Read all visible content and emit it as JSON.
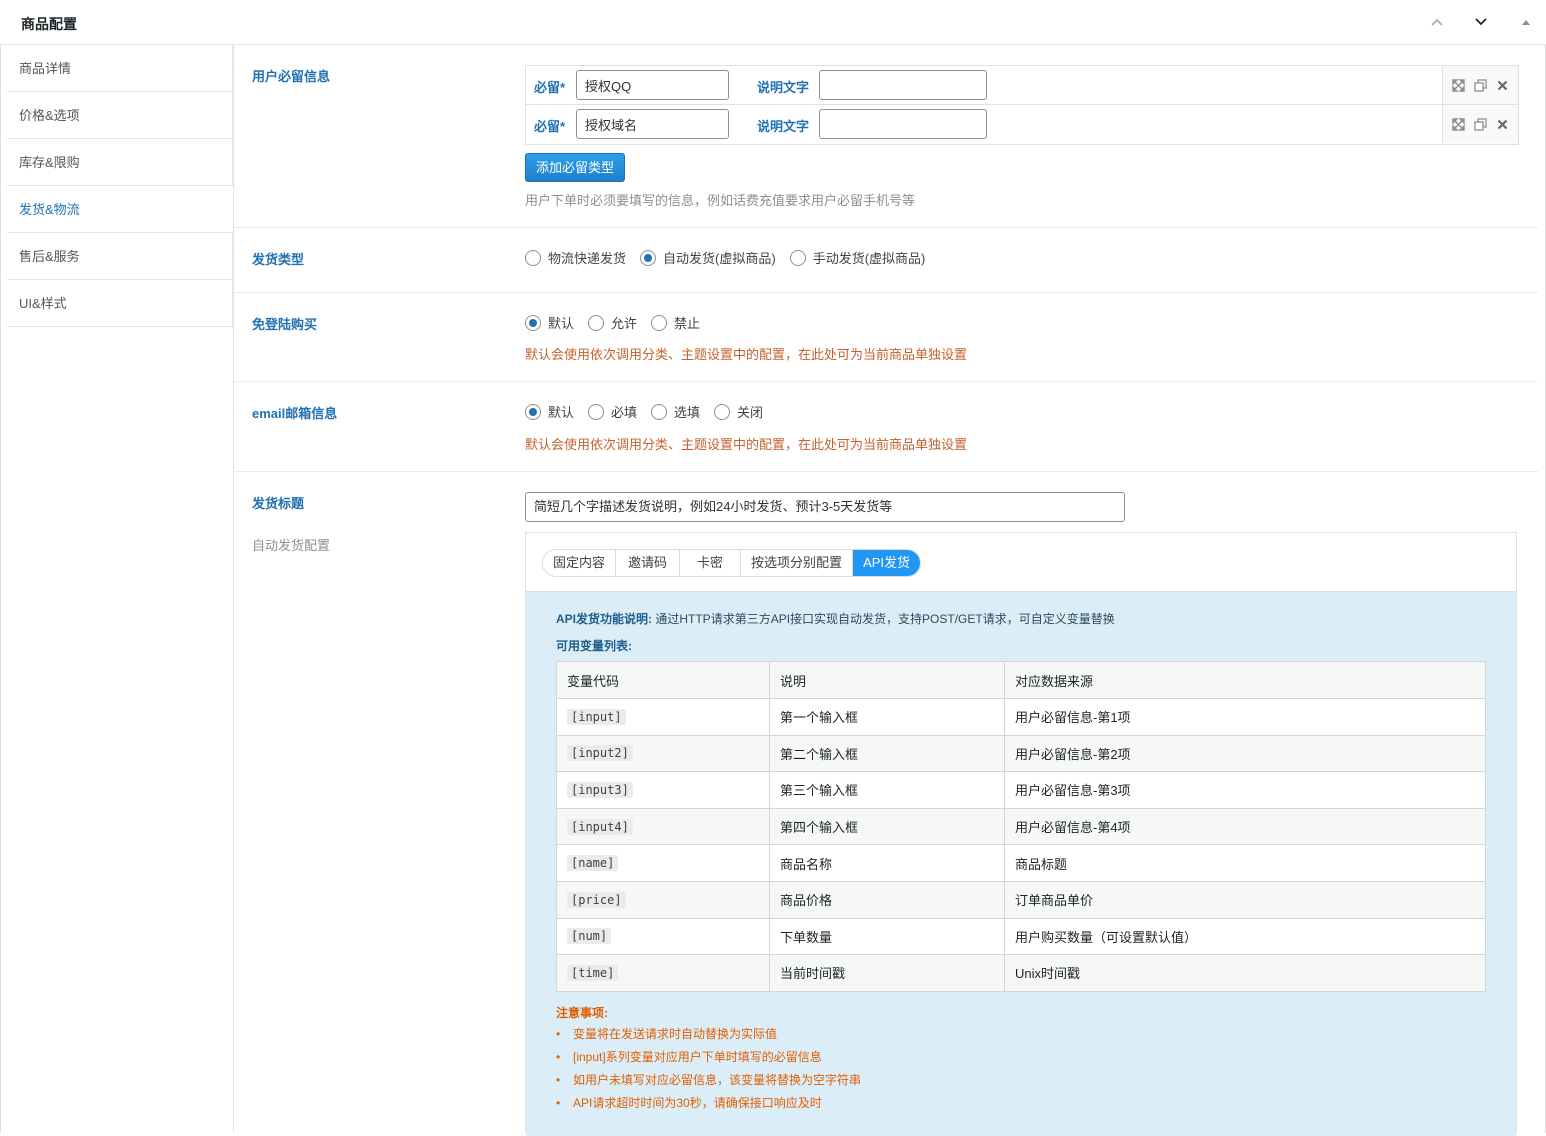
{
  "header": {
    "title": "商品配置"
  },
  "sidebar": {
    "items": [
      {
        "label": "商品详情"
      },
      {
        "label": "价格&选项"
      },
      {
        "label": "库存&限购"
      },
      {
        "label": "发货&物流"
      },
      {
        "label": "售后&服务"
      },
      {
        "label": "UI&样式"
      }
    ],
    "active_index": 3
  },
  "required_info": {
    "label": "用户必留信息",
    "rows": [
      {
        "req_label": "必留*",
        "value": "授权QQ",
        "desc_label": "说明文字",
        "desc_value": ""
      },
      {
        "req_label": "必留*",
        "value": "授权域名",
        "desc_label": "说明文字",
        "desc_value": ""
      }
    ],
    "add_button": "添加必留类型",
    "help": "用户下单时必须要填写的信息，例如话费充值要求用户必留手机号等"
  },
  "ship_type": {
    "label": "发货类型",
    "options": [
      "物流快递发货",
      "自动发货(虚拟商品)",
      "手动发货(虚拟商品)"
    ],
    "selected": 1
  },
  "guest_buy": {
    "label": "免登陆购买",
    "options": [
      "默认",
      "允许",
      "禁止"
    ],
    "selected": 0,
    "help": "默认会使用依次调用分类、主题设置中的配置，在此处可为当前商品单独设置"
  },
  "email_info": {
    "label": "email邮箱信息",
    "options": [
      "默认",
      "必填",
      "选填",
      "关闭"
    ],
    "selected": 0,
    "help": "默认会使用依次调用分类、主题设置中的配置，在此处可为当前商品单独设置"
  },
  "ship_title": {
    "label": "发货标题",
    "value": "简短几个字描述发货说明，例如24小时发货、预计3-5天发货等",
    "sublabel": "自动发货配置"
  },
  "auto_ship": {
    "tabs": [
      "固定内容",
      "邀请码",
      "卡密",
      "按选项分别配置",
      "API发货"
    ],
    "active_tab": 4,
    "api": {
      "desc_title": "API发货功能说明:",
      "desc_text": "通过HTTP请求第三方API接口实现自动发货，支持POST/GET请求，可自定义变量替换",
      "vars_title": "可用变量列表:",
      "headers": [
        "变量代码",
        "说明",
        "对应数据来源"
      ],
      "rows": [
        [
          "[input]",
          "第一个输入框",
          "用户必留信息-第1项"
        ],
        [
          "[input2]",
          "第二个输入框",
          "用户必留信息-第2项"
        ],
        [
          "[input3]",
          "第三个输入框",
          "用户必留信息-第3项"
        ],
        [
          "[input4]",
          "第四个输入框",
          "用户必留信息-第4项"
        ],
        [
          "[name]",
          "商品名称",
          "商品标题"
        ],
        [
          "[price]",
          "商品价格",
          "订单商品单价"
        ],
        [
          "[num]",
          "下单数量",
          "用户购买数量（可设置默认值）"
        ],
        [
          "[time]",
          "当前时间戳",
          "Unix时间戳"
        ]
      ],
      "notes_title": "注意事项:",
      "notes": [
        "变量将在发送请求时自动替换为实际值",
        "[input]系列变量对应用户下单时填写的必留信息",
        "如用户未填写对应必留信息，该变量将替换为空字符串",
        "API请求超时时间为30秒，请确保接口响应及时"
      ]
    }
  },
  "colors": {
    "accent": "#2271b1",
    "tab_active": "#2196f3",
    "warning": "#c4622d",
    "notes": "#e35d00",
    "api_panel_bg": "#dbeef8"
  }
}
